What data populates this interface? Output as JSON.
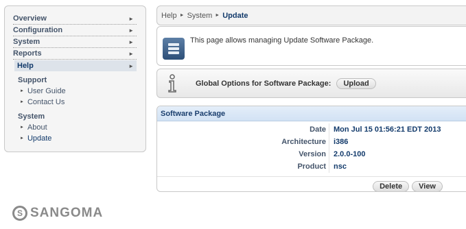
{
  "sidebar": {
    "nav": [
      {
        "label": "Overview"
      },
      {
        "label": "Configuration"
      },
      {
        "label": "System"
      },
      {
        "label": "Reports"
      },
      {
        "label": "Help"
      }
    ],
    "sections": [
      {
        "title": "Support",
        "links": [
          {
            "label": "User Guide"
          },
          {
            "label": "Contact Us"
          }
        ]
      },
      {
        "title": "System",
        "links": [
          {
            "label": "About"
          },
          {
            "label": "Update"
          }
        ]
      }
    ]
  },
  "logo": {
    "text": "SANGOMA"
  },
  "breadcrumb": {
    "items": [
      "Help",
      "System",
      "Update"
    ]
  },
  "info": {
    "text": "This page allows managing Update Software Package."
  },
  "options": {
    "label": "Global Options for Software Package:",
    "upload_label": "Upload"
  },
  "package": {
    "title": "Software Package",
    "rows": [
      {
        "label": "Date",
        "value": "Mon Jul 15 01:56:21 EDT 2013"
      },
      {
        "label": "Architecture",
        "value": "i386"
      },
      {
        "label": "Version",
        "value": "2.0.0-100"
      },
      {
        "label": "Product",
        "value": "nsc"
      }
    ],
    "delete_label": "Delete",
    "view_label": "View"
  },
  "colors": {
    "accent": "#123a6b",
    "nav_text": "#44546a",
    "header_bg": "#d2e2f4"
  }
}
